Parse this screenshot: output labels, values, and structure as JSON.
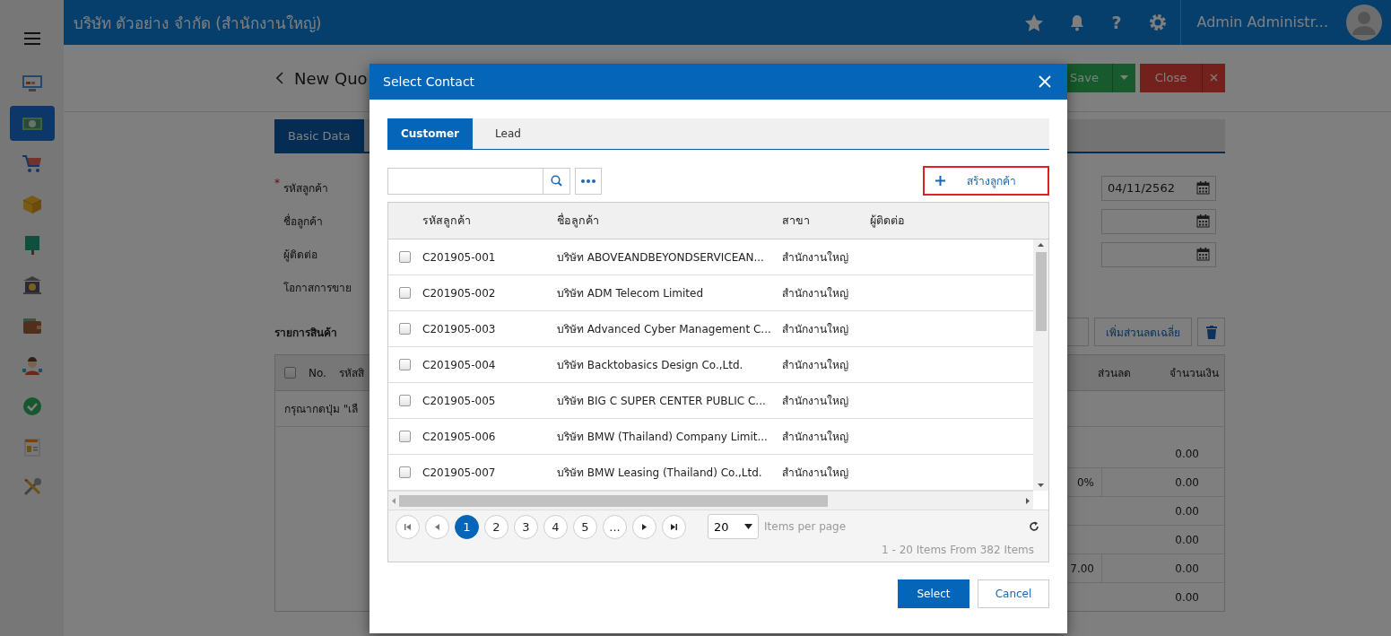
{
  "sidebar": {
    "items": [
      {
        "selected": false
      },
      {
        "selected": true
      },
      {
        "selected": false
      },
      {
        "selected": false
      },
      {
        "selected": false
      },
      {
        "selected": false
      },
      {
        "selected": false
      },
      {
        "selected": false
      },
      {
        "selected": false
      },
      {
        "selected": false
      },
      {
        "selected": false
      }
    ]
  },
  "top_bar": {
    "title": "บริษัท ตัวอย่าง จำกัด (สำนักงานใหญ่)",
    "help_label": "?",
    "user_name": "Admin Administr..."
  },
  "page": {
    "title": "New Quo",
    "buttons": [
      {
        "label": "Save",
        "kind": "save"
      },
      {
        "label": "Close",
        "kind": "close"
      }
    ],
    "tabs": [
      {
        "label": "Basic Data",
        "selected": true
      }
    ],
    "form_rows": [
      {
        "required_mark": "*",
        "label": "รหัสลูกค้า",
        "date_field": true,
        "date_value": "04/11/2562"
      },
      {
        "label": "ชื่อลูกค้า",
        "date_field": true
      },
      {
        "label": "ผู้ติดต่อ",
        "date_field": true
      },
      {
        "label": "โอกาสการขาย",
        "date_field": false
      }
    ],
    "items_section": {
      "title": "รายการสินค้า",
      "button": "เพิ่มส่วนลดเฉลี่ย",
      "columns": {
        "no": "No.",
        "code": "รหัสสิ",
        "discount": "ส่วนลด",
        "amount": "จำนวนเงิน"
      },
      "select_all_checked": false,
      "hint": "กรุณากดปุ่ม \"เลื",
      "summary_rows": [
        {
          "amount": "0.00"
        },
        {
          "column_1": "0%",
          "amount": "0.00"
        },
        {
          "amount": "0.00"
        },
        {
          "amount": "0.00"
        },
        {
          "column_1": "7.00",
          "amount": "0.00"
        },
        {
          "amount": "0.00"
        }
      ]
    }
  },
  "dialog": {
    "title": "Select Contact",
    "tabs": [
      {
        "label": "Customer",
        "selected": true
      },
      {
        "label": "Lead",
        "selected": false
      }
    ],
    "create_button": "สร้างลูกค้า",
    "columns": [
      "รหัสลูกค้า",
      "ชื่อลูกค้า",
      "สาขา",
      "ผู้ติดต่อ"
    ],
    "rows": [
      {
        "checked": false,
        "code": "C201905-001",
        "name": "บริษัท ABOVEANDBEYONDSERVICEAN...",
        "branch": "สำนักงานใหญ่"
      },
      {
        "checked": false,
        "code": "C201905-002",
        "name": "บริษัท ADM Telecom Limited",
        "branch": "สำนักงานใหญ่"
      },
      {
        "checked": false,
        "code": "C201905-003",
        "name": "บริษัท Advanced Cyber Management C...",
        "branch": "สำนักงานใหญ่"
      },
      {
        "checked": false,
        "code": "C201905-004",
        "name": "บริษัท Backtobasics Design Co.,Ltd.",
        "branch": "สำนักงานใหญ่"
      },
      {
        "checked": false,
        "code": "C201905-005",
        "name": "บริษัท BIG C SUPER CENTER PUBLIC C...",
        "branch": "สำนักงานใหญ่"
      },
      {
        "checked": false,
        "code": "C201905-006",
        "name": "บริษัท BMW (Thailand) Company Limit...",
        "branch": "สำนักงานใหญ่"
      },
      {
        "checked": false,
        "code": "C201905-007",
        "name": "บริษัท BMW Leasing (Thailand) Co.,Ltd.",
        "branch": "สำนักงานใหญ่"
      }
    ],
    "pager": {
      "pages": [
        {
          "label": "1",
          "selected": true
        },
        {
          "label": "2",
          "selected": false
        },
        {
          "label": "3",
          "selected": false
        },
        {
          "label": "4",
          "selected": false
        },
        {
          "label": "5",
          "selected": false
        },
        {
          "label": "...",
          "selected": false
        }
      ],
      "page_size": "20",
      "page_size_label": "Items per page",
      "summary": "1 - 20 Items From 382 Items"
    },
    "buttons": [
      {
        "label": "Select",
        "kind": "primary"
      },
      {
        "label": "Cancel",
        "kind": "secondary"
      }
    ]
  }
}
